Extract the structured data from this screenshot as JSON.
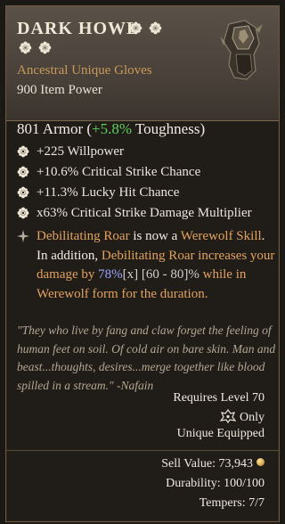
{
  "item": {
    "name": "DARK HOWL",
    "subtype": "Ancestral Unique Gloves",
    "item_power": "900 Item Power"
  },
  "armor": {
    "lead": "801 Armor (",
    "pct": "+5.8%",
    "tail": " Toughness)"
  },
  "affixes": [
    "+225 Willpower",
    "+10.6% Critical Strike Chance",
    "+11.3% Lucky Hit Chance",
    "x63% Critical Strike Damage Multiplier"
  ],
  "unique_power": {
    "p1": "Debilitating Roar ",
    "p2": "is now a ",
    "p3": "Werewolf Skill",
    "p4": ". In addition, ",
    "p5": "Debilitating Roar",
    "p6": " increases your damage by ",
    "p7": "78%",
    "p8": "[x] [60 - 80]%",
    "p9": " while in Werewolf form for the duration."
  },
  "lore": "\"They who live by fang and claw forget the feeling of human feet on soil. Of cold air on bare skin. Man and beast...thoughts, desires...merge together like blood spilled in a stream.\" -Nafain",
  "requirements": {
    "level": "Requires Level 70",
    "class_only": "Only",
    "unique_equipped": "Unique Equipped"
  },
  "footer": {
    "sell_value": "Sell Value: 73,943",
    "durability": "Durability: 100/100",
    "tempers": "Tempers: 7/7"
  },
  "icons": {
    "greater_affix": "flower-icon",
    "unique_power": "star-icon",
    "class": "druid-class-icon",
    "gold": "gold-coin-icon"
  },
  "colors": {
    "unique_orange": "#e3a35a",
    "item_type": "#c79a58",
    "positive": "#5fcf5f",
    "value_blue": "#9ea4ff"
  }
}
